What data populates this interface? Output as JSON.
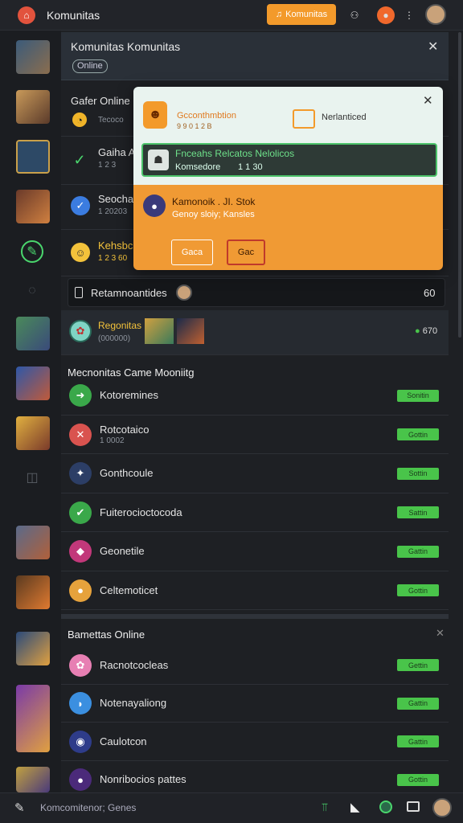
{
  "app": {
    "title": "Komunitas",
    "notify_label": "Komunitas"
  },
  "panel": {
    "title": "Komunitas Komunitas",
    "tag": "Online"
  },
  "left_rows": [
    {
      "label": "Gafer Online",
      "sub": "Tecoco"
    },
    {
      "label": "Gaiha Ac",
      "sub": "1 2 3"
    },
    {
      "label": "Seocha",
      "sub": "1 20203"
    },
    {
      "label": "Kehsbcs",
      "sub": "1 2 3 60"
    }
  ],
  "popup": {
    "badge_title": "Gcconthmbtion",
    "badge_sub": "9 9 0 1 2 B",
    "right_label": "Nerlanticed",
    "green_title": "Fnceahs Relcatos Nelolicos",
    "green_sub": "Komsedore",
    "green_num": "1 1 30",
    "orange_title": "Kamonoik . JI. Stok",
    "orange_sub": "Genoy sloiy; Kansles",
    "btn1": "Gaca",
    "btn2": "Gac"
  },
  "search": {
    "label": "Retamnoantides",
    "count": "60"
  },
  "featured": {
    "label": "Regonitas",
    "sub": "(000000)",
    "count": "670"
  },
  "section1": {
    "title": "Mecnonitas Came Mooniitg",
    "items": [
      {
        "label": "Kotoremines",
        "sub": "",
        "badge": "Sonitin",
        "color": "#3aa84a",
        "glyph": "➜"
      },
      {
        "label": "Rotcotaico",
        "sub": "1 0002",
        "badge": "Gottin",
        "color": "#d9534f",
        "glyph": "✕"
      },
      {
        "label": "Gonthcoule",
        "sub": "",
        "badge": "Sottin",
        "color": "#2c3e66",
        "glyph": "✦"
      },
      {
        "label": "Fuiterocioctocoda",
        "sub": "",
        "badge": "Sattin",
        "color": "#3aa84a",
        "glyph": "✔"
      },
      {
        "label": "Geonetile",
        "sub": "",
        "badge": "Gattin",
        "color": "#c2387a",
        "glyph": "◆"
      },
      {
        "label": "Celtemoticet",
        "sub": "",
        "badge": "Gottin",
        "color": "#e6a23c",
        "glyph": "●"
      }
    ]
  },
  "section2": {
    "title": "Bamettas Online",
    "items": [
      {
        "label": "Racnotcocleas",
        "badge": "Gettin",
        "color": "#e77fb3",
        "glyph": "✿"
      },
      {
        "label": "Notenayaliong",
        "badge": "Gattin",
        "color": "#3b8fe0",
        "glyph": "◗"
      },
      {
        "label": "Caulotcon",
        "badge": "Gattin",
        "color": "#2e3c8a",
        "glyph": "◉"
      },
      {
        "label": "Nonribocios pattes",
        "badge": "Gottin",
        "color": "#4b2a7a",
        "glyph": "●"
      }
    ]
  },
  "bottom": {
    "label": "Komcomitenor; Genes"
  },
  "icons": {
    "logo": "app-logo-icon",
    "bell": "bell-icon",
    "gamepad": "gamepad-icon",
    "menu": "more-vertical-icon",
    "close": "close-icon",
    "chat": "chat-bubble-icon",
    "edit": "pencil-icon",
    "chart": "chart-icon",
    "camera": "camera-icon",
    "circle": "status-icon",
    "screen": "screen-icon"
  },
  "colors": {
    "accent_orange": "#f39a2b",
    "accent_green": "#49c44a",
    "bg": "#1e2024"
  }
}
